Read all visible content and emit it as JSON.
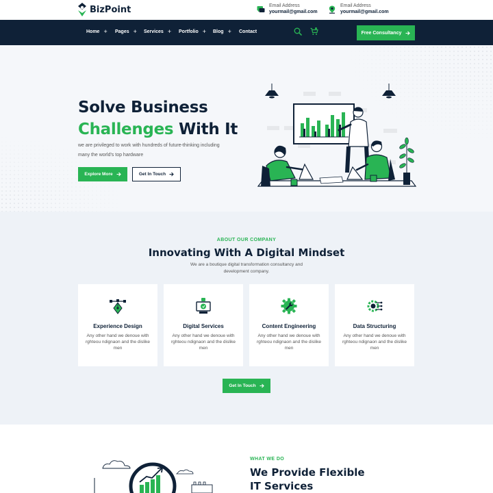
{
  "brand": {
    "name": "BizPoint",
    "accent": "#29b454",
    "dark": "#0f2137"
  },
  "topbar": {
    "contacts": [
      {
        "label": "Email Address",
        "value": "yourmail@gmail.com",
        "icon": "chat-icon"
      },
      {
        "label": "Email Address",
        "value": "yourmail@gmail.com",
        "icon": "location-icon"
      }
    ]
  },
  "nav": {
    "items": [
      {
        "label": "Home",
        "has_submenu": true
      },
      {
        "label": "Pages",
        "has_submenu": true
      },
      {
        "label": "Services",
        "has_submenu": true
      },
      {
        "label": "Portfolio",
        "has_submenu": true
      },
      {
        "label": "Blog",
        "has_submenu": true
      },
      {
        "label": "Contact",
        "has_submenu": false
      }
    ],
    "submenu_glyph": "+",
    "cta_label": "Free Consultancy"
  },
  "hero": {
    "title_line1": "Solve Business",
    "title_green": "Challenges",
    "title_rest": " With It",
    "description": "we are privileged to work with hundreds of future-thinking including many the world's top hardware",
    "primary_label": "Explore More",
    "secondary_label": "Get In Touch"
  },
  "about": {
    "eyebrow": "ABOUT OUR COMPANY",
    "title": "Innovating With A Digital Mindset",
    "description": "We are a boutique digital transformation consultancy and development company.",
    "cards": [
      {
        "title": "Experience Design",
        "desc": "Any other hand we denoue with rghteou ndignaon and the dislike men",
        "icon": "pen-tool-icon"
      },
      {
        "title": "Digital Services",
        "desc": "Any other hand we denoue with rghteou ndignaon and the dislike men",
        "icon": "digital-screen-icon"
      },
      {
        "title": "Content Engineering",
        "desc": "Any other hand we denoue with rghteou ndignaon and the dislike men",
        "icon": "gear-wrench-icon"
      },
      {
        "title": "Data Structuring",
        "desc": "Any other hand we denoue with rghteou ndignaon and the dislike men",
        "icon": "circuit-gear-icon"
      }
    ],
    "button_label": "Get In Touch"
  },
  "what_we_do": {
    "eyebrow": "WHAT WE DO",
    "title_line1": "We Provide Flexible",
    "title_line2": "IT Services"
  }
}
